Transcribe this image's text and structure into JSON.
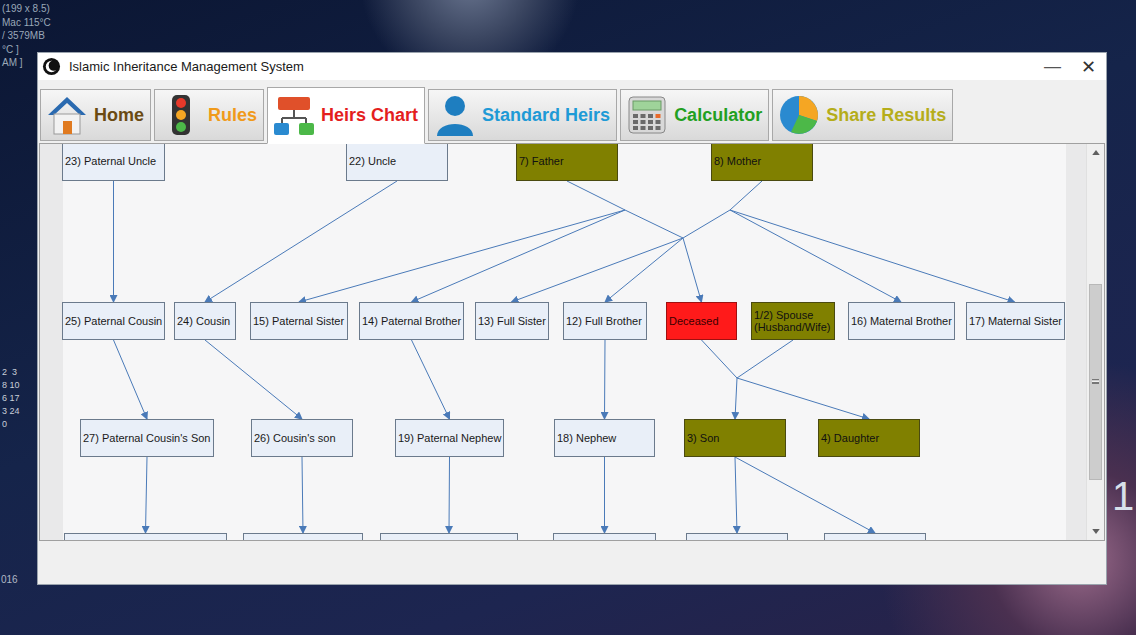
{
  "window": {
    "title": "Islamic Inheritance Management System",
    "minimize": "—",
    "close": "✕"
  },
  "tabs": [
    {
      "label": "Home",
      "selected": false,
      "color": "#6b4a12"
    },
    {
      "label": "Rules",
      "selected": false,
      "color": "#f09a1a"
    },
    {
      "label": "Heirs Chart",
      "selected": true,
      "color": "#e41e1e"
    },
    {
      "label": "Standard Heirs",
      "selected": false,
      "color": "#1e9ad6"
    },
    {
      "label": "Calculator",
      "selected": false,
      "color": "#22a022"
    },
    {
      "label": "Share Results",
      "selected": false,
      "color": "#b5ad1a"
    }
  ],
  "chart": {
    "nodes": [
      {
        "id": "23",
        "label": "23) Paternal Uncle",
        "kind": "plain"
      },
      {
        "id": "22",
        "label": "22) Uncle",
        "kind": "plain"
      },
      {
        "id": "7",
        "label": "7) Father",
        "kind": "highlighted"
      },
      {
        "id": "8",
        "label": "8) Mother",
        "kind": "highlighted"
      },
      {
        "id": "25",
        "label": "25) Paternal Cousin",
        "kind": "plain"
      },
      {
        "id": "24",
        "label": "24) Cousin",
        "kind": "plain"
      },
      {
        "id": "15",
        "label": "15) Paternal Sister",
        "kind": "plain"
      },
      {
        "id": "14",
        "label": "14) Paternal Brother",
        "kind": "plain"
      },
      {
        "id": "13",
        "label": "13) Full Sister",
        "kind": "plain"
      },
      {
        "id": "12",
        "label": "12) Full Brother",
        "kind": "plain"
      },
      {
        "id": "d",
        "label": "Deceased",
        "kind": "deceased"
      },
      {
        "id": "1",
        "label": "1/2) Spouse\n(Husband/Wife)",
        "kind": "highlighted"
      },
      {
        "id": "16",
        "label": "16) Maternal Brother",
        "kind": "plain"
      },
      {
        "id": "17",
        "label": "17) Maternal Sister",
        "kind": "plain"
      },
      {
        "id": "27",
        "label": "27) Paternal Cousin's Son",
        "kind": "plain"
      },
      {
        "id": "26",
        "label": "26) Cousin's son",
        "kind": "plain"
      },
      {
        "id": "19",
        "label": "19) Paternal Nephew",
        "kind": "plain"
      },
      {
        "id": "18",
        "label": "18) Nephew",
        "kind": "plain"
      },
      {
        "id": "3",
        "label": "3) Son",
        "kind": "highlighted"
      },
      {
        "id": "4",
        "label": "4) Daughter",
        "kind": "highlighted"
      },
      {
        "id": "r1",
        "label": "",
        "kind": "plain"
      },
      {
        "id": "r2",
        "label": "",
        "kind": "plain"
      },
      {
        "id": "r3",
        "label": "",
        "kind": "plain"
      },
      {
        "id": "r4",
        "label": "",
        "kind": "plain"
      },
      {
        "id": "r5",
        "label": "",
        "kind": "plain"
      },
      {
        "id": "r6",
        "label": "",
        "kind": "plain"
      }
    ],
    "edges": [
      {
        "from": "23",
        "to": "25",
        "arrow": true
      },
      {
        "from": "22",
        "to": "24",
        "arrow": true
      },
      {
        "from": "7",
        "to": "jF",
        "arrow": false
      },
      {
        "from": "jF",
        "to": "15",
        "arrow": true
      },
      {
        "from": "jF",
        "to": "14",
        "arrow": true
      },
      {
        "from": "jF",
        "to": "jP",
        "arrow": false
      },
      {
        "from": "8",
        "to": "jM",
        "arrow": false
      },
      {
        "from": "jM",
        "to": "jP",
        "arrow": false
      },
      {
        "from": "jM",
        "to": "16",
        "arrow": true
      },
      {
        "from": "jM",
        "to": "17",
        "arrow": true
      },
      {
        "from": "jP",
        "to": "13",
        "arrow": true
      },
      {
        "from": "jP",
        "to": "12",
        "arrow": true
      },
      {
        "from": "jP",
        "to": "d",
        "arrow": true
      },
      {
        "from": "d",
        "to": "jS",
        "arrow": false
      },
      {
        "from": "1",
        "to": "jS",
        "arrow": false
      },
      {
        "from": "jS",
        "to": "3",
        "arrow": true
      },
      {
        "from": "jS",
        "to": "4",
        "arrow": true
      },
      {
        "from": "25",
        "to": "27",
        "arrow": true
      },
      {
        "from": "24",
        "to": "26",
        "arrow": true
      },
      {
        "from": "14",
        "to": "19",
        "arrow": true
      },
      {
        "from": "12",
        "to": "18",
        "arrow": true
      },
      {
        "from": "27",
        "to": "r1",
        "arrow": true
      },
      {
        "from": "26",
        "to": "r2",
        "arrow": true
      },
      {
        "from": "19",
        "to": "r3",
        "arrow": true
      },
      {
        "from": "18",
        "to": "r4",
        "arrow": true
      },
      {
        "from": "3",
        "to": "r5",
        "arrow": true
      },
      {
        "from": "3",
        "to": "r6",
        "arrow": true
      }
    ]
  },
  "scrollbar": {
    "position": 0.34,
    "size": 0.54
  },
  "desktop": {
    "widgets": [
      "(199 x 8.5)",
      "Mac 115°C",
      "/ 3579MB",
      "°C ]",
      "AM ]"
    ],
    "calendar": [
      "2  3",
      "8 10",
      "6 17",
      "3 24",
      "0"
    ],
    "year": "016",
    "clock": "1"
  }
}
